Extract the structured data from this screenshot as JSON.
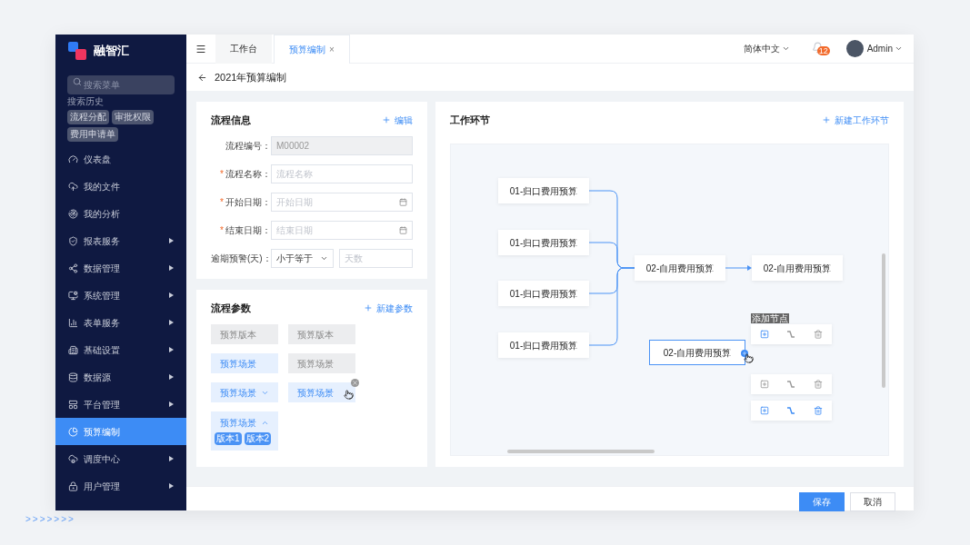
{
  "decoration_text": ">>>>>>>",
  "sidebar": {
    "logo": "融智汇",
    "search_placeholder": "搜索菜单",
    "history_label": "搜索历史",
    "history_tags": [
      "流程分配",
      "审批权限",
      "费用申请单"
    ],
    "items": [
      {
        "label": "仪表盘",
        "has_submenu": false,
        "selected": false
      },
      {
        "label": "我的文件",
        "has_submenu": false,
        "selected": false
      },
      {
        "label": "我的分析",
        "has_submenu": false,
        "selected": false
      },
      {
        "label": "报表服务",
        "has_submenu": true,
        "selected": false
      },
      {
        "label": "数据管理",
        "has_submenu": true,
        "selected": false
      },
      {
        "label": "系统管理",
        "has_submenu": true,
        "selected": false
      },
      {
        "label": "表单服务",
        "has_submenu": true,
        "selected": false
      },
      {
        "label": "基础设置",
        "has_submenu": true,
        "selected": false
      },
      {
        "label": "数据源",
        "has_submenu": true,
        "selected": false
      },
      {
        "label": "平台管理",
        "has_submenu": true,
        "selected": false
      },
      {
        "label": "预算编制",
        "has_submenu": false,
        "selected": true
      },
      {
        "label": "调度中心",
        "has_submenu": true,
        "selected": false
      },
      {
        "label": "用户管理",
        "has_submenu": true,
        "selected": false
      }
    ]
  },
  "tabs": [
    {
      "label": "工作台",
      "selected": false,
      "closable": false
    },
    {
      "label": "预算编制",
      "selected": true,
      "closable": true,
      "close_glyph": "×"
    }
  ],
  "header": {
    "language": "简体中文",
    "notification_count": "12",
    "user": "Admin"
  },
  "page_title": "2021年预算编制",
  "process_info": {
    "title": "流程信息",
    "action": "编辑",
    "required_mark": "*",
    "fields": [
      {
        "kind": "text",
        "label": "流程编号：",
        "required": false,
        "disabled": true,
        "value": "M00002"
      },
      {
        "kind": "text",
        "label": "流程名称：",
        "required": true,
        "disabled": false,
        "placeholder": "流程名称"
      },
      {
        "kind": "date",
        "label": "开始日期：",
        "required": true,
        "disabled": false,
        "placeholder": "开始日期"
      },
      {
        "kind": "date",
        "label": "结束日期：",
        "required": true,
        "disabled": false,
        "placeholder": "结束日期"
      },
      {
        "kind": "compare",
        "label": "逾期预警(天)：",
        "required": false,
        "select_value": "小于等于",
        "placeholder": "天数"
      }
    ]
  },
  "process_params": {
    "title": "流程参数",
    "action": "新建参数",
    "items": [
      {
        "kind": "plain",
        "label": "预算版本",
        "selected": false,
        "removable": false
      },
      {
        "kind": "plain",
        "label": "预算版本",
        "selected": false,
        "removable": false
      },
      {
        "kind": "plain",
        "label": "预算场景",
        "selected": true,
        "removable": false
      },
      {
        "kind": "plain",
        "label": "预算场景",
        "selected": false,
        "removable": false
      },
      {
        "kind": "dropdown",
        "label": "预算场景",
        "selected": true,
        "removable": false,
        "expanded": false
      },
      {
        "kind": "plain",
        "label": "预算场景",
        "selected": true,
        "removable": true
      },
      {
        "kind": "dropdown",
        "label": "预算场景",
        "selected": true,
        "removable": false,
        "expanded": true,
        "options": [
          "版本1",
          "版本2"
        ]
      }
    ]
  },
  "workflow": {
    "title": "工作环节",
    "action": "新建工作环节",
    "nodes": [
      {
        "label": "01-归口费用预算",
        "selected": false
      },
      {
        "label": "01-归口费用预算",
        "selected": false
      },
      {
        "label": "01-归口费用预算",
        "selected": false
      },
      {
        "label": "01-归口费用预算",
        "selected": false
      },
      {
        "label": "02-自用费用预算",
        "selected": false
      },
      {
        "label": "02-自用费用预算",
        "selected": false
      },
      {
        "label": "02-自用费用预算",
        "selected": true
      }
    ],
    "tooltip": "添加节点",
    "toolbars": [
      {
        "tools": [
          {
            "kind": "add",
            "active": true
          },
          {
            "kind": "connect",
            "active": false
          },
          {
            "kind": "delete",
            "active": false
          }
        ]
      },
      {
        "tools": [
          {
            "kind": "add",
            "active": false
          },
          {
            "kind": "connect",
            "active": false
          },
          {
            "kind": "delete",
            "active": false
          }
        ]
      },
      {
        "tools": [
          {
            "kind": "add",
            "active": true
          },
          {
            "kind": "connect",
            "active": true
          },
          {
            "kind": "delete",
            "active": true
          }
        ]
      }
    ]
  },
  "footer_buttons": [
    {
      "label": "保存",
      "kind": "primary"
    },
    {
      "label": "取消",
      "kind": "default"
    }
  ]
}
